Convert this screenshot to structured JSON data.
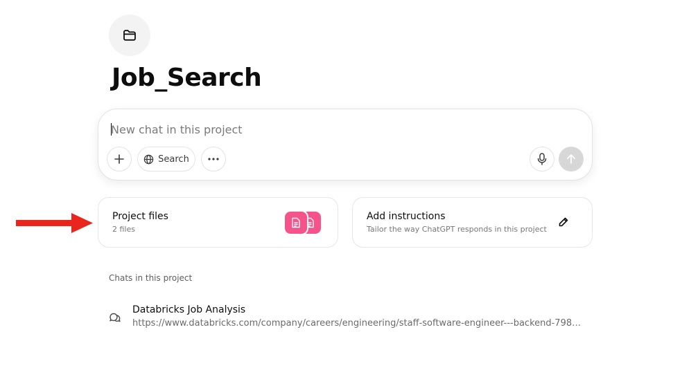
{
  "project": {
    "icon": "folder-icon",
    "title": "Job_Search"
  },
  "composer": {
    "placeholder": "New chat in this project",
    "value": "",
    "buttons": {
      "add_icon": "plus-icon",
      "search_label": "Search",
      "search_icon": "globe-icon",
      "more_icon": "more-horizontal-icon",
      "mic_icon": "microphone-icon",
      "send_icon": "arrow-up-icon"
    }
  },
  "cards": {
    "files": {
      "title": "Project files",
      "subtitle": "2 files",
      "tile_color": "#f5538a"
    },
    "instructions": {
      "title": "Add instructions",
      "subtitle": "Tailor the way ChatGPT responds in this project",
      "icon": "pencil-icon"
    }
  },
  "annotation": {
    "arrow_color": "#e8261c",
    "target": "Project files"
  },
  "chats": {
    "section_label": "Chats in this project",
    "items": [
      {
        "title": "Databricks Job Analysis",
        "subtitle": "https://www.databricks.com/company/careers/engineering/staff-software-engineer---backend-79849..."
      }
    ]
  }
}
